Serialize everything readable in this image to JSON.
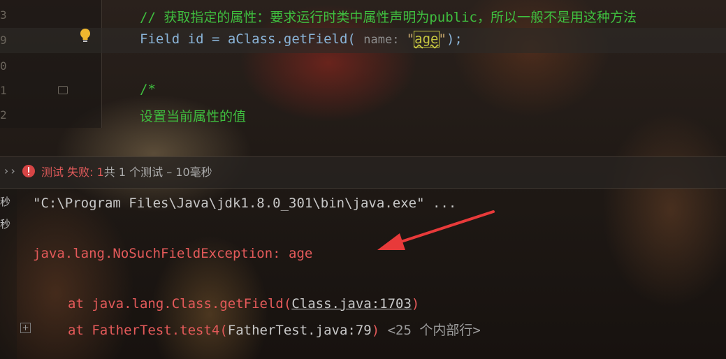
{
  "editor": {
    "line_numbers": [
      "3",
      "9",
      "0",
      "1",
      "2"
    ],
    "comment_line": "// 获取指定的属性：要求运行时类中属性声明为public，所以一般不是用这种方法",
    "code_line": {
      "part1": "Field id = aClass.getField( ",
      "hint": "name: ",
      "quote_open": "\"",
      "arg": "age",
      "quote_close": "\"",
      "end": ");"
    },
    "comment_open": "/*",
    "comment_text": "设置当前属性的值",
    "bulb_icon": "lightbulb-icon"
  },
  "run_bar": {
    "chevron": "››",
    "status_fail": "测试 失败: 1",
    "status_rest": "共 1 个测试 – 10毫秒"
  },
  "console": {
    "left_labels": [
      "秒",
      "秒"
    ],
    "command": "\"C:\\Program Files\\Java\\jdk1.8.0_301\\bin\\java.exe\" ...",
    "exception": "java.lang.NoSuchFieldException: age",
    "stack": [
      {
        "at": "at ",
        "method": "java.lang.Class.getField(",
        "file": "Class.java:1703",
        "close": ")",
        "extra": ""
      },
      {
        "at": "at ",
        "method": "FatherTest.test4(",
        "file": "FatherTest.java:79",
        "close": ")",
        "extra": " <25 个内部行>"
      }
    ],
    "expand_label": "+"
  },
  "colors": {
    "comment": "#3fbf3f",
    "error": "#e45a5a",
    "arrow": "#e83a3a"
  }
}
